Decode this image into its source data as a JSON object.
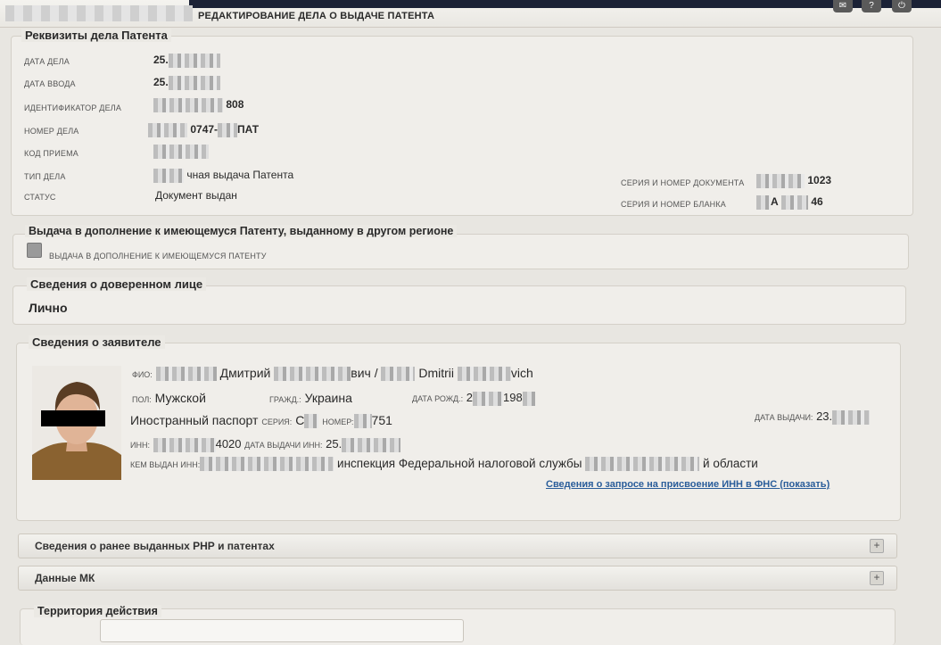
{
  "header": {
    "title": "РЕДАКТИРОВАНИЕ ДЕЛА О ВЫДАЧЕ ПАТЕНТА"
  },
  "case": {
    "legend": "Реквизиты дела Патента",
    "date_label": "ДАТА ДЕЛА",
    "date_value": "25.",
    "entry_label": "ДАТА ВВОДА",
    "entry_value": "25.",
    "id_label": "ИДЕНТИФИКАТОР ДЕЛА",
    "id_value": "808",
    "number_label": "НОМЕР ДЕЛА",
    "number_value": "0747-",
    "number_suffix": "ПАТ",
    "receipt_label": "КОД ПРИЕМА",
    "type_label": "ТИП ДЕЛА",
    "type_value": "чная выдача Патента",
    "status_label": "СТАТУС",
    "status_value": "Документ выдан",
    "doc_series_label": "СЕРИЯ И НОМЕР ДОКУМЕНТА",
    "doc_series_value": "1023",
    "form_series_label": "СЕРИЯ И НОМЕР БЛАНКА",
    "form_series_a": "А",
    "form_series_value": "46"
  },
  "addition": {
    "legend": "Выдача в дополнение к имеющемуся Патенту, выданному в другом регионе",
    "checkbox_label": "ВЫДАЧА В ДОПОЛНЕНИЕ К ИМЕЮЩЕМУСЯ ПАТЕНТУ"
  },
  "trustee": {
    "legend": "Сведения о доверенном лице",
    "value": "Лично"
  },
  "applicant": {
    "legend": "Сведения о заявителе",
    "fio_label": "ФИО:",
    "name_ru": "Дмитрий",
    "patronymic_ru": "вич /",
    "name_en": "Dmitrii",
    "patronymic_en": "vich",
    "sex_label": "ПОЛ:",
    "sex_value": "Мужской",
    "citizenship_label": "ГРАЖД.:",
    "citizenship_value": "Украина",
    "birth_label": "ДАТА РОЖД.:",
    "birth_a": "2",
    "birth_b": "198",
    "passport": "Иностранный паспорт",
    "series_label": "СЕРИЯ:",
    "series_value": "С",
    "number_label": "НОМЕР:",
    "number_value": "751",
    "issue_label": "ДАТА ВЫДАЧИ:",
    "issue_value": "23.",
    "inn_label": "ИНН:",
    "inn_value": "4020",
    "inn_date_label": "ДАТА ВЫДАЧИ ИНН:",
    "inn_date_value": "25.",
    "inn_issuer_label": "КЕМ ВЫДАН ИНН:",
    "inn_issuer_value": "инспекция Федеральной налоговой службы",
    "inn_issuer_suffix": "й области",
    "fns_link": "Сведения о запросе на присвоение ИНН в ФНС (показать)"
  },
  "sections": {
    "prev_permits": "Сведения о ранее выданных РНР и патентах",
    "mk_data": "Данные МК",
    "territory": "Территория действия"
  },
  "icons": {
    "plus": "+",
    "tb1": "mail-icon",
    "tb2": "help-icon",
    "tb3": "power-icon"
  }
}
